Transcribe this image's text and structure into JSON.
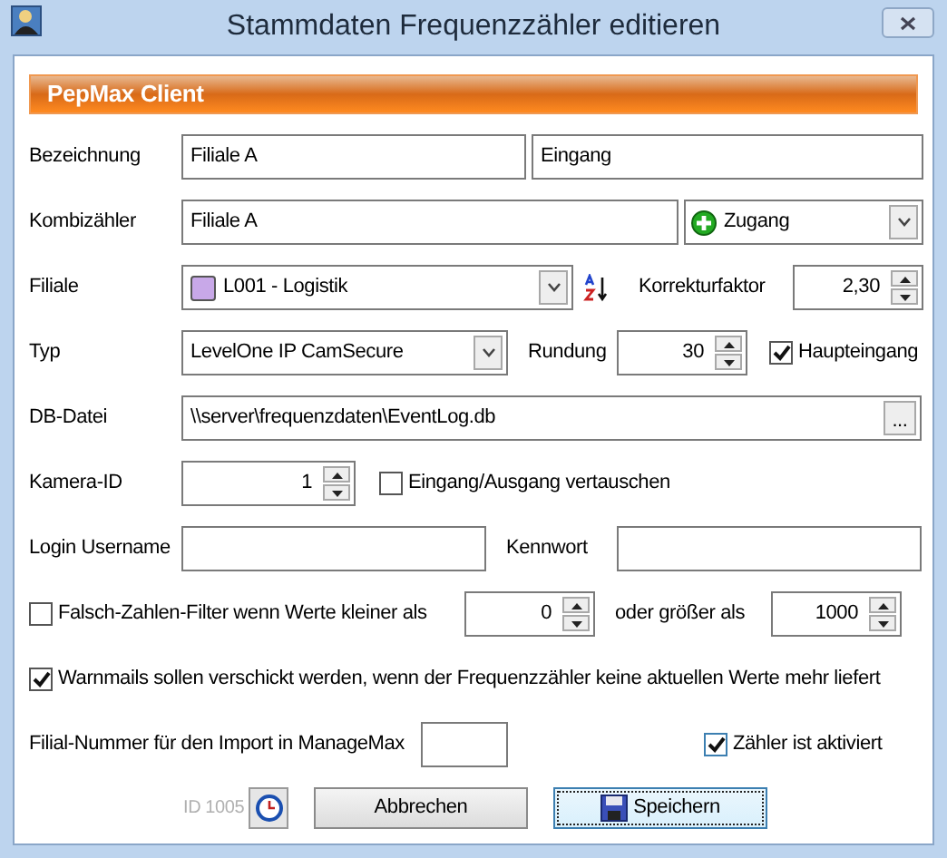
{
  "window": {
    "title": "Stammdaten Frequenzzähler editieren"
  },
  "header": "PepMax Client",
  "bezeichnung": {
    "label": "Bezeichnung",
    "value_1": "Filiale A",
    "value_2": "Eingang"
  },
  "kombizaehler": {
    "label": "Kombizähler",
    "value": "Filiale A",
    "mode": "Zugang"
  },
  "filiale": {
    "label": "Filiale",
    "value": "L001 - Logistik",
    "color": "#c8a8e8",
    "korrektur_label": "Korrekturfaktor",
    "korrektur": "2,30"
  },
  "typ": {
    "label": "Typ",
    "value": "LevelOne IP CamSecure",
    "rundung_label": "Rundung",
    "rundung": "30",
    "haupteingang": {
      "label": "Haupteingang",
      "checked": true
    }
  },
  "db_datei": {
    "label": "DB-Datei",
    "value": "\\\\server\\frequenzdaten\\EventLog.db",
    "browse": "..."
  },
  "kamera": {
    "label": "Kamera-ID",
    "value": "1",
    "swap": {
      "label": "Eingang/Ausgang vertauschen",
      "checked": false
    }
  },
  "login": {
    "label": "Login Username",
    "password_label": "Kennwort"
  },
  "filter": {
    "label": "Falsch-Zahlen-Filter wenn Werte kleiner als",
    "checked": false,
    "min": "0",
    "max_label": "oder größer als",
    "max": "1000"
  },
  "warnmails": {
    "label": "Warnmails sollen verschickt werden, wenn der Frequenzzähler keine aktuellen Werte mehr liefert",
    "checked": true
  },
  "import": {
    "label": "Filial-Nummer für den Import in ManageMax",
    "active": {
      "label": "Zähler ist aktiviert",
      "checked": true
    }
  },
  "id_text": "ID 1005",
  "buttons": [
    "Abbrechen",
    "Speichern"
  ]
}
